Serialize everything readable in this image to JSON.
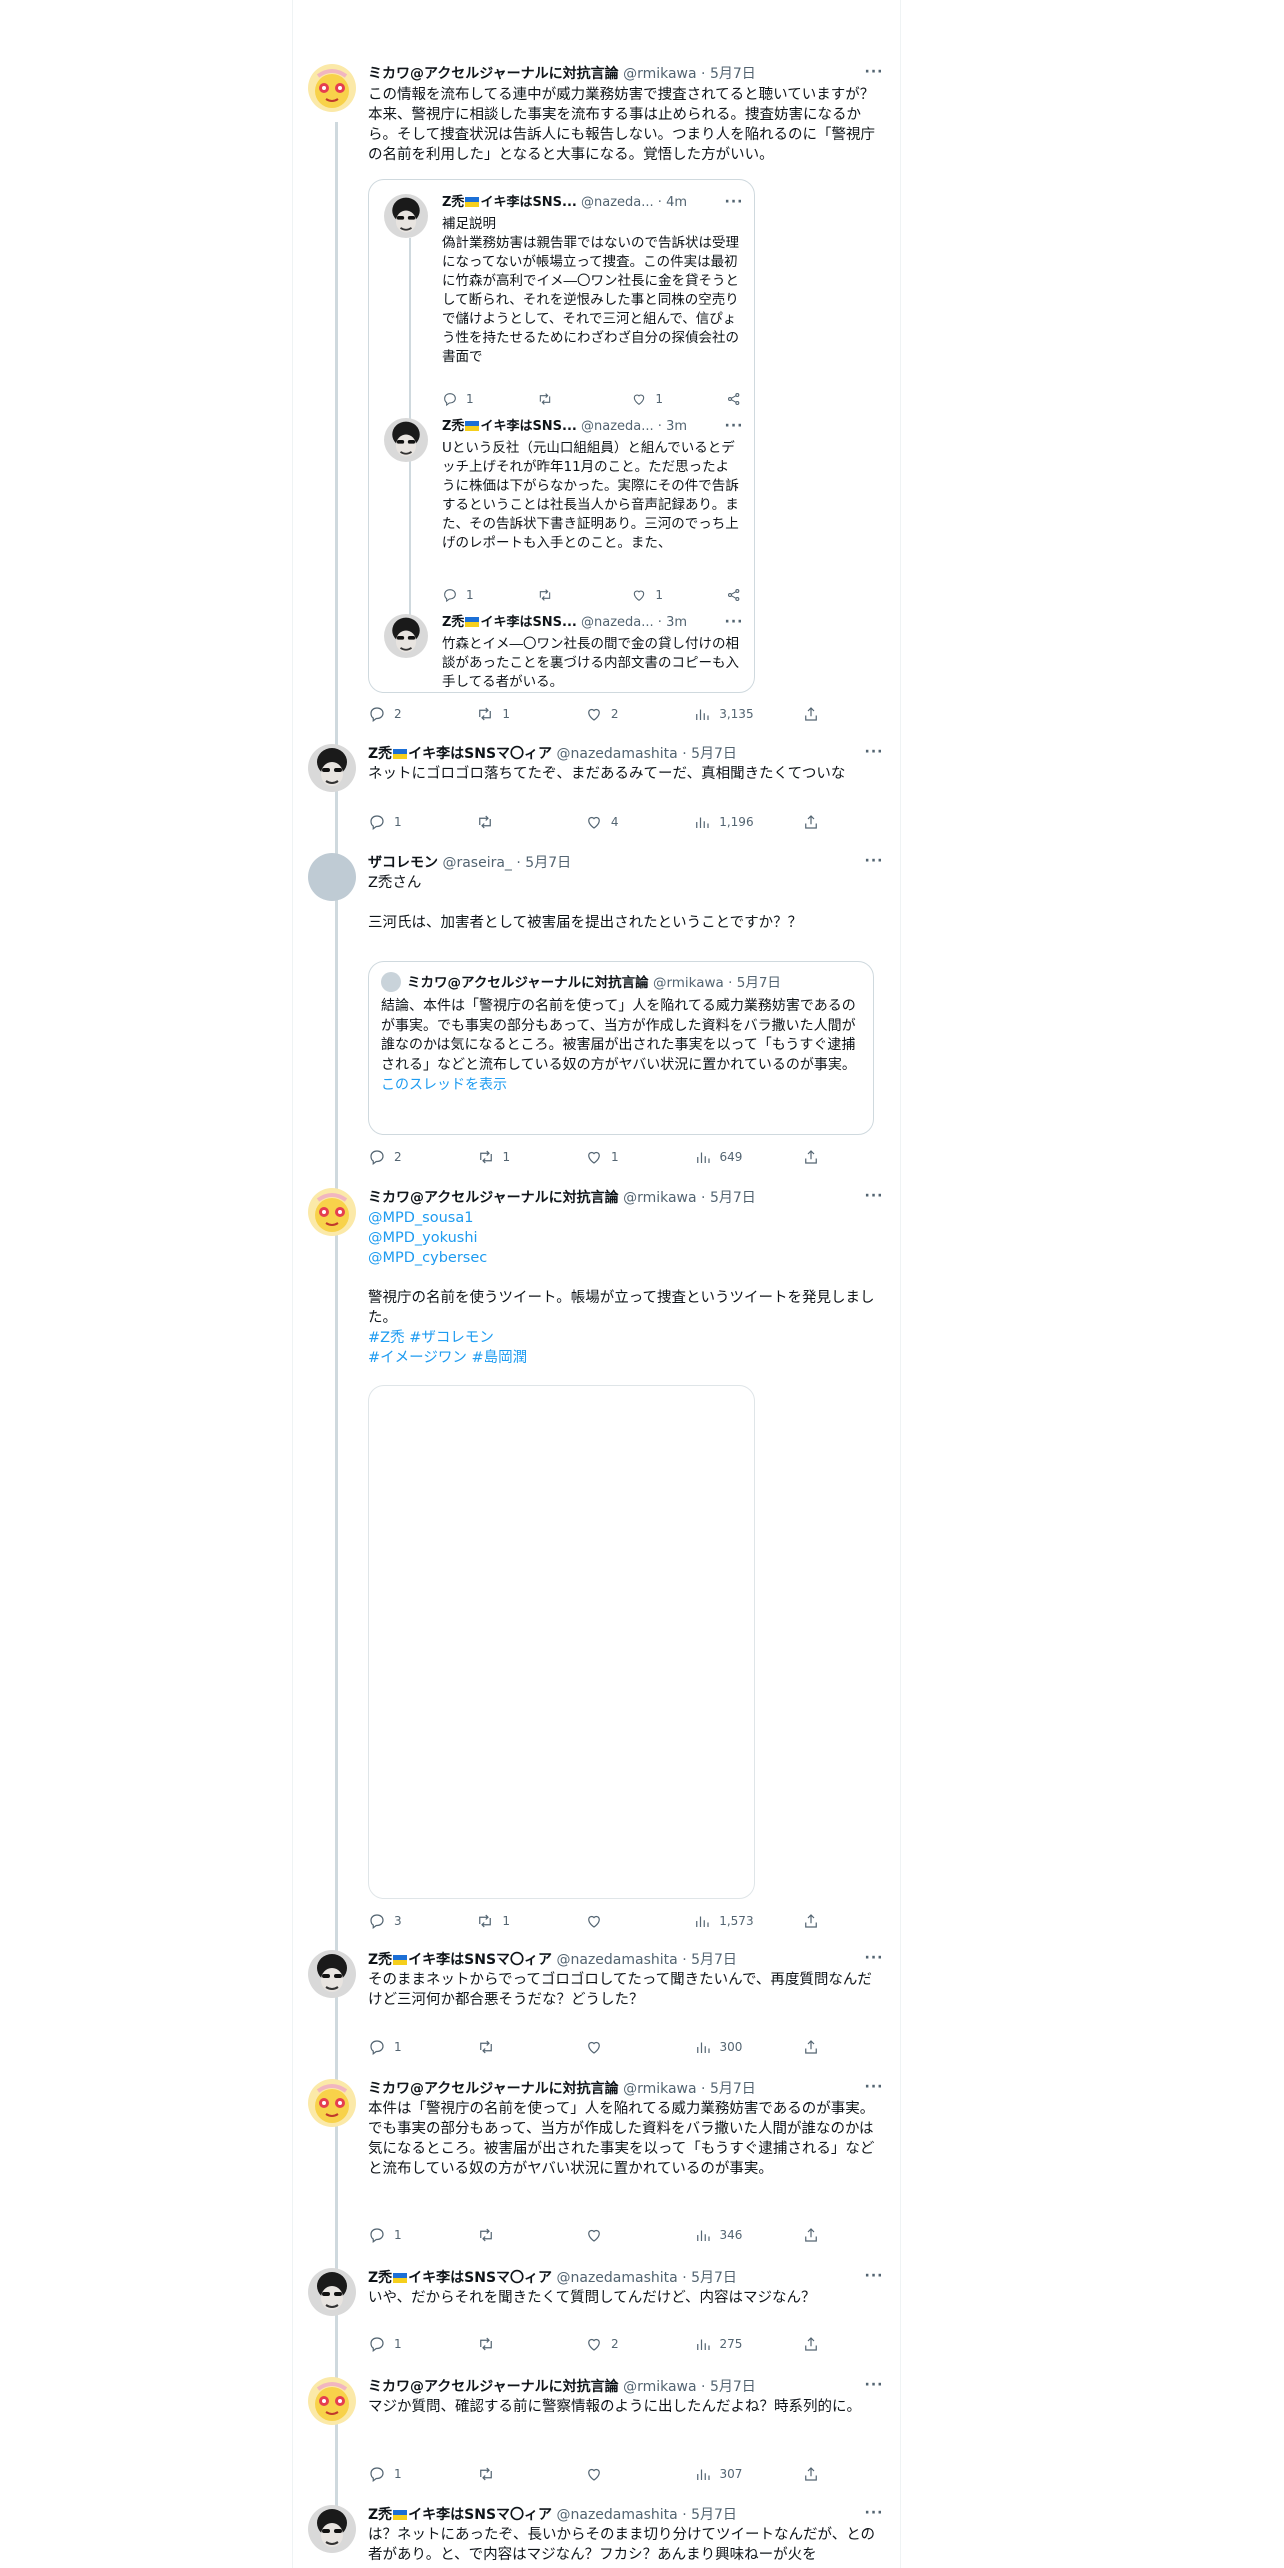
{
  "more_label": "···",
  "tweets": [
    {
      "name": "ミカワ@アクセルジャーナルに対抗言論",
      "handle": "@rmikawa",
      "time": "5月7日",
      "text": "この情報を流布してる連中が威力業務妨害で捜査されてると聴いていますが？本来、警視庁に相談した事実を流布する事は止められる。捜査妨害になるから。そして捜査状況は告訴人にも報告しない。つまり人を陥れるのに「警視庁の名前を利用した」となると大事になる。覚悟した方がいい。",
      "replies": "2",
      "retweets": "1",
      "likes": "2",
      "views": "3,135"
    },
    {
      "name_a": "Z禿",
      "name_b": "イキ李はSNSマ〇ィア",
      "handle": "@nazedamashita",
      "time": "5月7日",
      "text": "ネットにゴロゴロ落ちてたぞ、まだあるみてーだ、真相聞きたくてついな",
      "replies": "1",
      "retweets": "",
      "likes": "4",
      "views": "1,196"
    },
    {
      "name": "ザコレモン",
      "handle": "@raseira_",
      "time": "5月7日",
      "text": "Z禿さん\n\n三河氏は、加害者として被害届を提出されたということですか？？",
      "replies": "2",
      "retweets": "1",
      "likes": "1",
      "views": "649"
    },
    {
      "name": "ミカワ@アクセルジャーナルに対抗言論",
      "handle": "@rmikawa",
      "time": "5月7日",
      "mentions": [
        "@MPD_sousa1",
        "@MPD_yokushi",
        "@MPD_cybersec"
      ],
      "text": "警視庁の名前を使うツイート。帳場が立って捜査というツイートを発見しました。",
      "hashtags_1": "#Z禿 #ザコレモン",
      "hashtags_2": "#イメージワン #島岡潤",
      "replies": "3",
      "retweets": "1",
      "likes": "",
      "views": "1,573"
    },
    {
      "name_a": "Z禿",
      "name_b": "イキ李はSNSマ〇ィア",
      "handle": "@nazedamashita",
      "time": "5月7日",
      "text": "そのままネットからでってゴロゴロしてたって聞きたいんで、再度質問なんだけど三河何か都合悪そうだな？どうした？",
      "replies": "1",
      "retweets": "",
      "likes": "",
      "views": "300"
    },
    {
      "name": "ミカワ@アクセルジャーナルに対抗言論",
      "handle": "@rmikawa",
      "time": "5月7日",
      "text": "本件は「警視庁の名前を使って」人を陥れてる威力業務妨害であるのが事実。でも事実の部分もあって、当方が作成した資料をバラ撒いた人間が誰なのかは気になるところ。被害届が出された事実を以って「もうすぐ逮捕される」などと流布している奴の方がヤバい状況に置かれているのが事実。",
      "replies": "1",
      "retweets": "",
      "likes": "",
      "views": "346"
    },
    {
      "name_a": "Z禿",
      "name_b": "イキ李はSNSマ〇ィア",
      "handle": "@nazedamashita",
      "time": "5月7日",
      "text": "いや、だからそれを聞きたくて質問してんだけど、内容はマジなん？",
      "replies": "1",
      "retweets": "",
      "likes": "2",
      "views": "275"
    },
    {
      "name": "ミカワ@アクセルジャーナルに対抗言論",
      "handle": "@rmikawa",
      "time": "5月7日",
      "text": "マジか質問、確認する前に警察情報のように出したんだよね？時系列的に。",
      "replies": "1",
      "retweets": "",
      "likes": "",
      "views": "307"
    },
    {
      "name_a": "Z禿",
      "name_b": "イキ李はSNSマ〇ィア",
      "handle": "@nazedamashita",
      "time": "5月7日",
      "text": "は？ネットにあったぞ、長いからそのまま切り分けてツイートなんだが、との者があり。と、で内容はマジなん？フカシ？あんまり興味ねーが火を"
    }
  ],
  "embedded_thread": [
    {
      "name_a": "Z禿",
      "name_b": "イキ李はSNS...",
      "handle": "@nazeda...",
      "time": "4m",
      "text": "補足説明\n偽計業務妨害は親告罪ではないので告訴状は受理になってないが帳場立って捜査。この件実は最初に竹森が高利でイメ―〇ワン社長に金を貸そうとして断られ、それを逆恨みした事と同株の空売りで儲けようとして、それで三河と組んで、信ぴょう性を持たせるためにわざわざ自分の探偵会社の書面で",
      "replies": "1",
      "likes": "1"
    },
    {
      "name_a": "Z禿",
      "name_b": "イキ李はSNS...",
      "handle": "@nazeda...",
      "time": "3m",
      "text": "Uという反社（元山口組組員）と組んでいるとデッチ上げそれが昨年11月のこと。ただ思ったように株価は下がらなかった。実際にその件で告訴するということは社長当人から音声記録あり。また、その告訴状下書き証明あり。三河のでっち上げのレポートも入手とのこと。また、",
      "replies": "1",
      "likes": "1"
    },
    {
      "name_a": "Z禿",
      "name_b": "イキ李はSNS...",
      "handle": "@nazeda...",
      "time": "3m",
      "text": "竹森とイメ―〇ワン社長の間で金の貸し付けの相談があったことを裏づける内部文書のコピーも入手してる者がいる。"
    }
  ],
  "quoted": {
    "name": "ミカワ@アクセルジャーナルに対抗言論",
    "handle": "@rmikawa",
    "time": "5月7日",
    "text": "結論、本件は「警視庁の名前を使って」人を陥れてる威力業務妨害であるのが事実。でも事実の部分もあって、当方が作成した資料をバラ撒いた人間が誰なのかは気になるところ。被害届が出された事実を以って「もうすぐ逮捕される」などと流布している奴の方がヤバい状況に置かれているのが事実。",
    "show_thread": "このスレッドを表示"
  }
}
